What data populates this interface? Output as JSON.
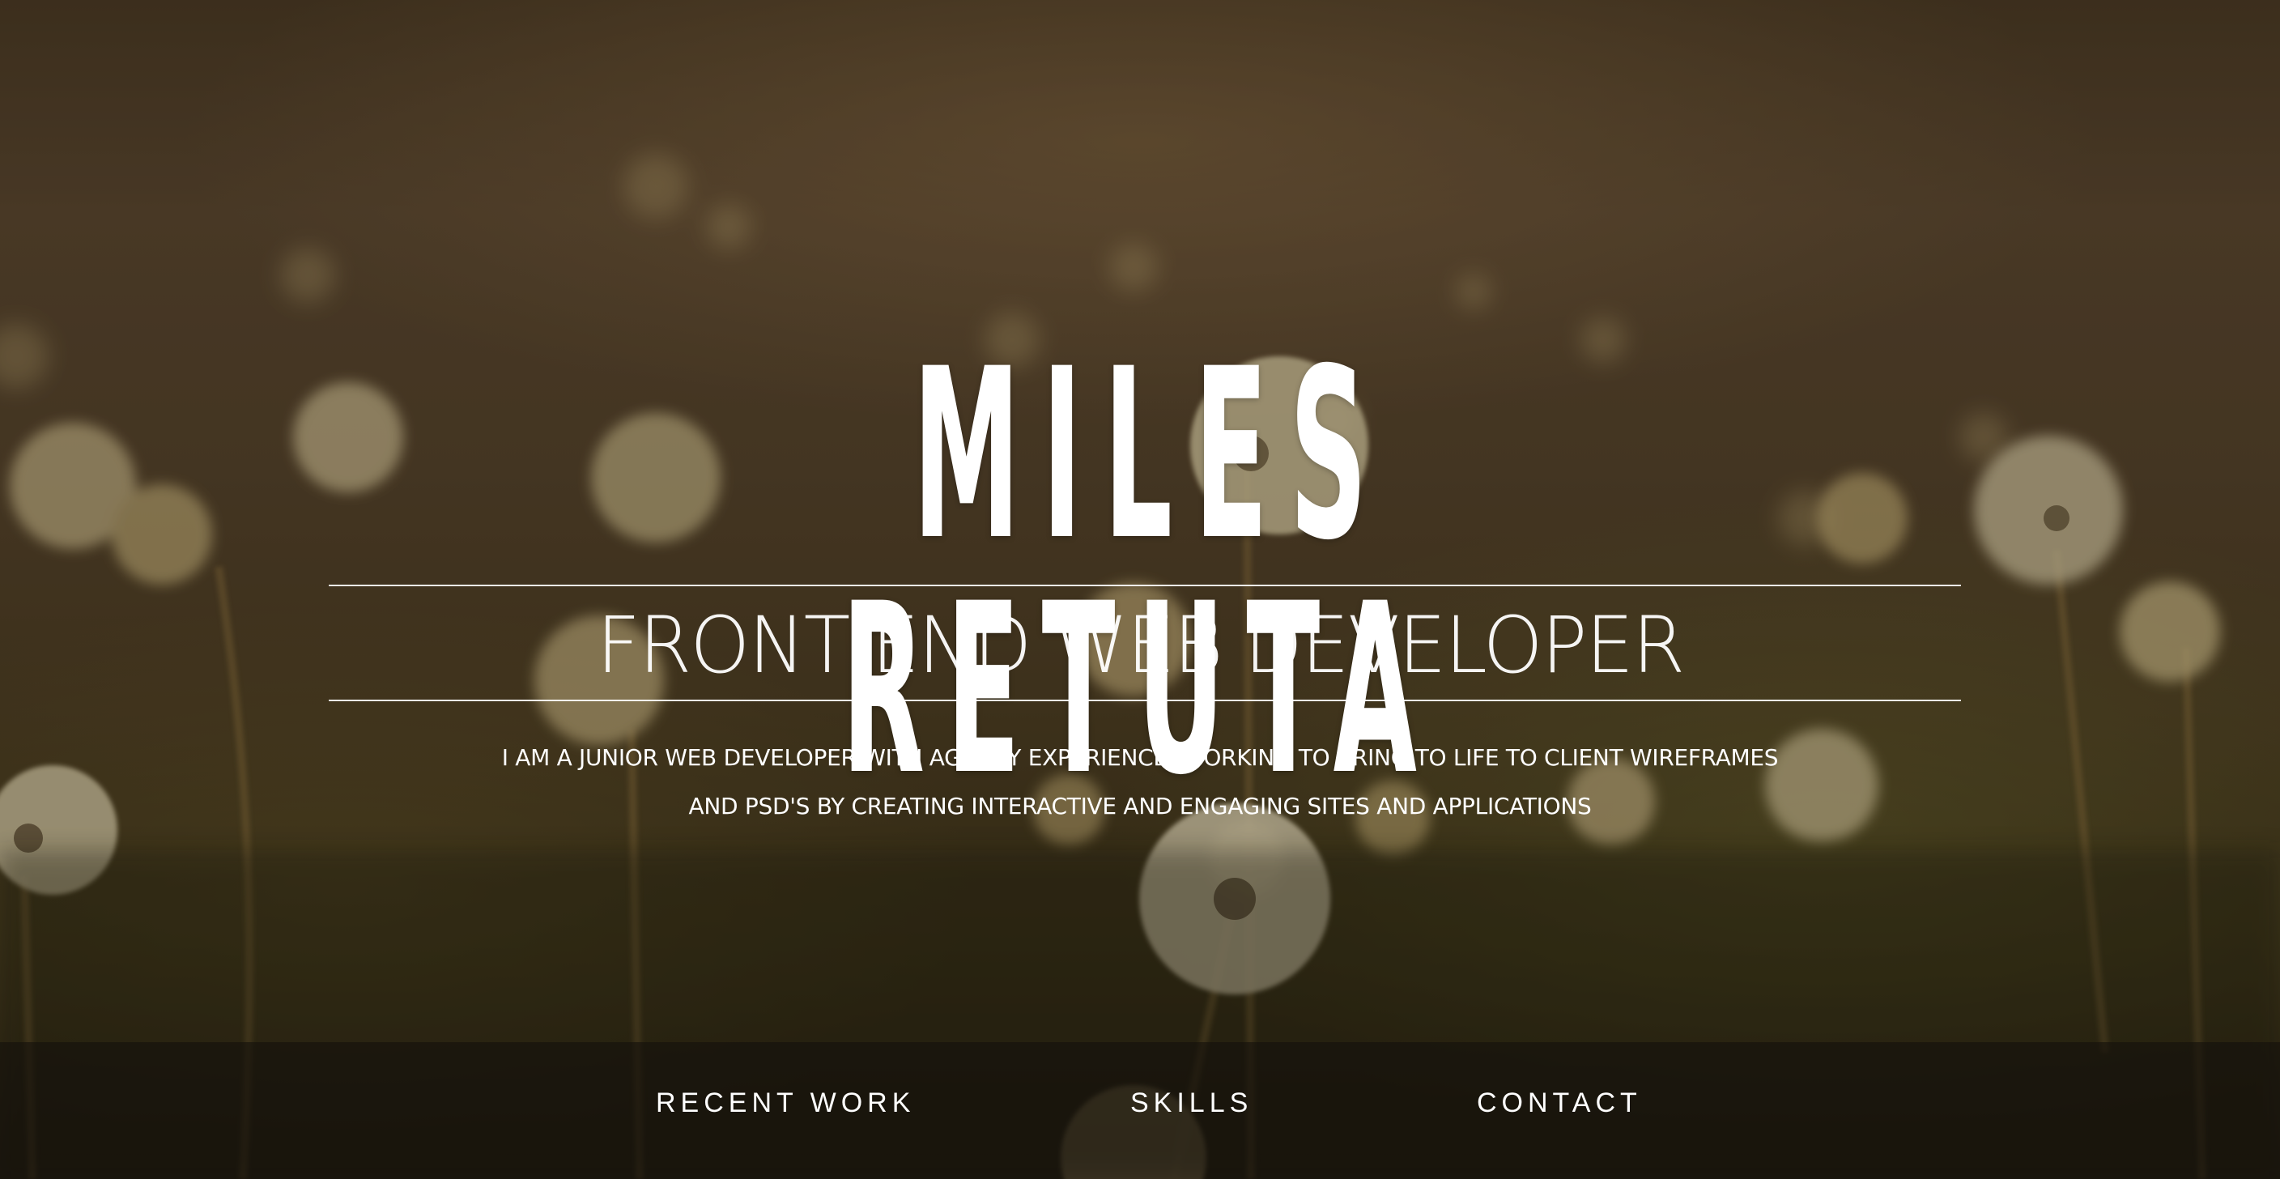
{
  "hero": {
    "name": "MILES RETUTA",
    "title": "FRONT END WEB DEVELOPER",
    "bio_line_1": "I AM A JUNIOR WEB DEVELOPER WITH AGENCY EXPERIENCE, WORKING TO BRING TO LIFE TO CLIENT WIREFRAMES",
    "bio_line_2": "AND PSD'S BY CREATING INTERACTIVE AND ENGAGING SITES AND APPLICATIONS"
  },
  "nav": {
    "items": [
      {
        "label": "RECENT WORK"
      },
      {
        "label": "SKILLS"
      },
      {
        "label": "CONTACT"
      }
    ]
  },
  "colors": {
    "text": "#ffffff",
    "nav_background": "#14100c",
    "background_tone": "#4a3a24"
  }
}
